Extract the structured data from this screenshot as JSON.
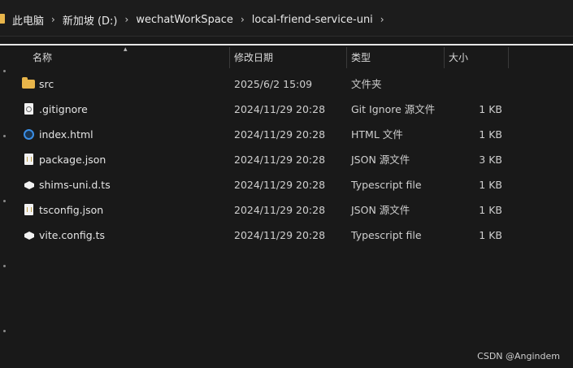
{
  "breadcrumb": [
    "此电脑",
    "新加坡 (D:)",
    "wechatWorkSpace",
    "local-friend-service-uni"
  ],
  "columns": {
    "name": "名称",
    "date": "修改日期",
    "type": "类型",
    "size": "大小"
  },
  "files": [
    {
      "name": "src",
      "date": "2025/6/2 15:09",
      "type": "文件夹",
      "size": "",
      "icon": "folder-icon"
    },
    {
      "name": ".gitignore",
      "date": "2024/11/29 20:28",
      "type": "Git Ignore 源文件",
      "size": "1 KB",
      "icon": "gear-file-icon"
    },
    {
      "name": "index.html",
      "date": "2024/11/29 20:28",
      "type": "HTML 文件",
      "size": "1 KB",
      "icon": "html-file-icon"
    },
    {
      "name": "package.json",
      "date": "2024/11/29 20:28",
      "type": "JSON 源文件",
      "size": "3 KB",
      "icon": "json-file-icon"
    },
    {
      "name": "shims-uni.d.ts",
      "date": "2024/11/29 20:28",
      "type": "Typescript file",
      "size": "1 KB",
      "icon": "typescript-file-icon"
    },
    {
      "name": "tsconfig.json",
      "date": "2024/11/29 20:28",
      "type": "JSON 源文件",
      "size": "1 KB",
      "icon": "json-file-icon"
    },
    {
      "name": "vite.config.ts",
      "date": "2024/11/29 20:28",
      "type": "Typescript file",
      "size": "1 KB",
      "icon": "typescript-file-icon"
    }
  ],
  "watermark": "CSDN @Angindem",
  "colors": {
    "background": "#191919",
    "folder": "#e8b54a",
    "html_icon": "#3a8ee6"
  }
}
